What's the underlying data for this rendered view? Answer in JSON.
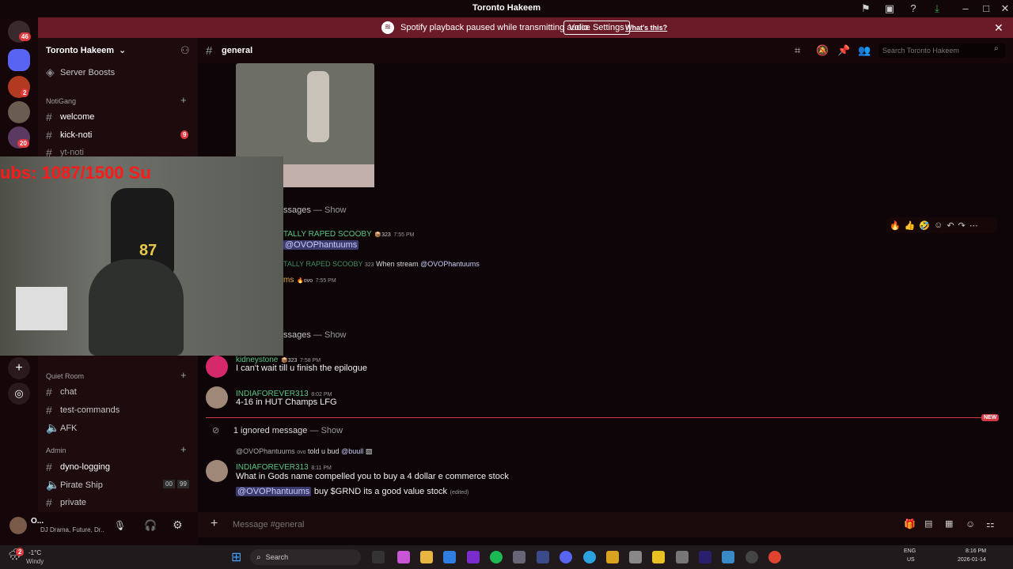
{
  "window": {
    "title": "Toronto Hakeem"
  },
  "banner": {
    "text": "Spotify playback paused while transmitting audio.",
    "button": "Voice Settings",
    "link": "What's this?"
  },
  "servers": {
    "home_badge": "46",
    "badges": [
      "2",
      "20"
    ]
  },
  "sidebar": {
    "server_name": "Toronto Hakeem",
    "boosts": "Server Boosts",
    "categories": [
      {
        "name": "NotiGang",
        "channels": [
          {
            "name": "welcome",
            "style": "white"
          },
          {
            "name": "kick-noti",
            "style": "white",
            "badge": "9"
          },
          {
            "name": "yt-noti",
            "style": "dim"
          }
        ]
      },
      {
        "name": "Quiet Room",
        "channels": [
          {
            "name": "chat"
          },
          {
            "name": "test-commands"
          },
          {
            "name": "AFK"
          }
        ]
      },
      {
        "name": "Admin",
        "channels": [
          {
            "name": "dyno-logging",
            "style": "white"
          },
          {
            "name": "Pirate Ship",
            "voice_counts": [
              "00",
              "99"
            ]
          },
          {
            "name": "private"
          }
        ]
      }
    ]
  },
  "user": {
    "name": "O...",
    "status": "DJ Drama, Future, Dr..."
  },
  "chat": {
    "channel": "general",
    "search_placeholder": "Search Toronto Hakeem",
    "hidden_1": "ssages",
    "show": "Show",
    "scooby_user": "TALLY RAPED SCOOBY",
    "scooby_tag": "323",
    "scooby_time": "7:55 PM",
    "scooby_mention": "@OVOPhantuums",
    "reply_user": "TALLY RAPED SCOOBY",
    "reply_tag": "323",
    "reply_text": "When stream",
    "reply_mention": "@OVOPhantuums",
    "ms_name": "ms",
    "ms_tag": "ovo",
    "ms_time": "7:55 PM",
    "hidden_2": "ssages",
    "kidney_user": "kidneystone",
    "kidney_tag": "323",
    "kidney_time": "7:58 PM",
    "kidney_text": "I can't wait till u finish the epilogue",
    "india_user": "INDIAFOREVER313",
    "india_time_1": "8:02 PM",
    "india_text_1": "4-16 in HUT Champs LFG",
    "new_badge": "NEW",
    "ignored": "1 ignored message",
    "reply2_user": "@OVOPhantuums",
    "reply2_tag": "ovo",
    "reply2_text": "told u bud",
    "reply2_mention": "@buull",
    "india_time_2": "8:11 PM",
    "india_text_2": "What in Gods name compelled you to buy a 4 dollar e commerce stock",
    "india_mention": "@OVOPhantuums",
    "india_text_3": "buy $GRND its a good value stock",
    "edited": "(edited)",
    "composer_placeholder": "Message #general"
  },
  "overlay": {
    "subs": "ubs: 1087/1500  Su",
    "jersey": "87"
  },
  "taskbar": {
    "temp": "-1°C",
    "weather": "Windy",
    "search": "Search",
    "lang": "ENG",
    "region": "US",
    "time": "8:16 PM",
    "date": "2026-01-14",
    "weather_badge": "2"
  }
}
